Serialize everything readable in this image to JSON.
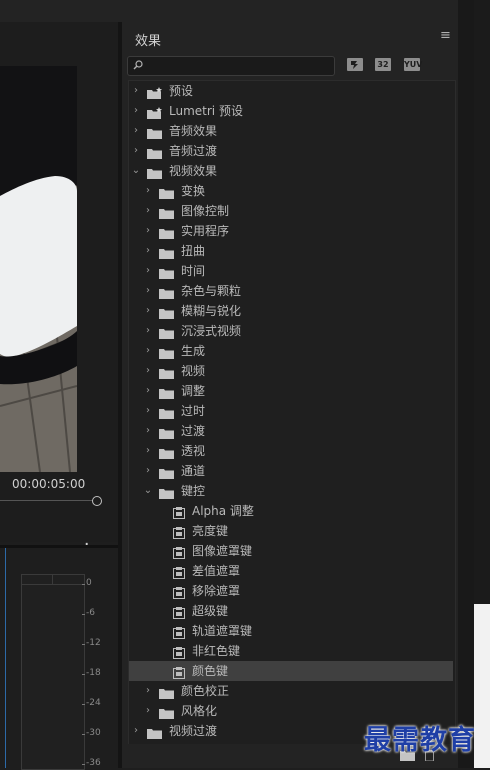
{
  "monitor": {
    "timecode": "00:00:05:00",
    "add_button": "+",
    "meter_scale": [
      "0",
      "-6",
      "-12",
      "-18",
      "-24",
      "-30",
      "-36"
    ]
  },
  "effects_panel": {
    "title": "效果",
    "menu_icon": "hamburger-menu-icon",
    "search": {
      "value": "",
      "icon": "search-icon"
    },
    "toolbar": [
      {
        "name": "accelerated-effects-icon",
        "label": ""
      },
      {
        "name": "32bit-color-icon",
        "label": "32"
      },
      {
        "name": "yuv-effects-icon",
        "label": "YUV"
      }
    ],
    "tree": [
      {
        "label": "预设",
        "level": 0,
        "kind": "star-folder",
        "expanded": false
      },
      {
        "label": "Lumetri 预设",
        "level": 0,
        "kind": "star-folder",
        "expanded": false
      },
      {
        "label": "音频效果",
        "level": 0,
        "kind": "folder",
        "expanded": false
      },
      {
        "label": "音频过渡",
        "level": 0,
        "kind": "folder",
        "expanded": false
      },
      {
        "label": "视频效果",
        "level": 0,
        "kind": "folder",
        "expanded": true
      },
      {
        "label": "变换",
        "level": 1,
        "kind": "folder",
        "expanded": false
      },
      {
        "label": "图像控制",
        "level": 1,
        "kind": "folder",
        "expanded": false
      },
      {
        "label": "实用程序",
        "level": 1,
        "kind": "folder",
        "expanded": false
      },
      {
        "label": "扭曲",
        "level": 1,
        "kind": "folder",
        "expanded": false
      },
      {
        "label": "时间",
        "level": 1,
        "kind": "folder",
        "expanded": false
      },
      {
        "label": "杂色与颗粒",
        "level": 1,
        "kind": "folder",
        "expanded": false
      },
      {
        "label": "模糊与锐化",
        "level": 1,
        "kind": "folder",
        "expanded": false
      },
      {
        "label": "沉浸式视频",
        "level": 1,
        "kind": "folder",
        "expanded": false
      },
      {
        "label": "生成",
        "level": 1,
        "kind": "folder",
        "expanded": false
      },
      {
        "label": "视频",
        "level": 1,
        "kind": "folder",
        "expanded": false
      },
      {
        "label": "调整",
        "level": 1,
        "kind": "folder",
        "expanded": false
      },
      {
        "label": "过时",
        "level": 1,
        "kind": "folder",
        "expanded": false
      },
      {
        "label": "过渡",
        "level": 1,
        "kind": "folder",
        "expanded": false
      },
      {
        "label": "透视",
        "level": 1,
        "kind": "folder",
        "expanded": false
      },
      {
        "label": "通道",
        "level": 1,
        "kind": "folder",
        "expanded": false
      },
      {
        "label": "键控",
        "level": 1,
        "kind": "folder",
        "expanded": true
      },
      {
        "label": "Alpha 调整",
        "level": 2,
        "kind": "effect"
      },
      {
        "label": "亮度键",
        "level": 2,
        "kind": "effect"
      },
      {
        "label": "图像遮罩键",
        "level": 2,
        "kind": "effect"
      },
      {
        "label": "差值遮罩",
        "level": 2,
        "kind": "effect"
      },
      {
        "label": "移除遮罩",
        "level": 2,
        "kind": "effect"
      },
      {
        "label": "超级键",
        "level": 2,
        "kind": "effect"
      },
      {
        "label": "轨道遮罩键",
        "level": 2,
        "kind": "effect"
      },
      {
        "label": "非红色键",
        "level": 2,
        "kind": "effect"
      },
      {
        "label": "颜色键",
        "level": 2,
        "kind": "effect",
        "selected": true
      },
      {
        "label": "颜色校正",
        "level": 1,
        "kind": "folder",
        "expanded": false
      },
      {
        "label": "风格化",
        "level": 1,
        "kind": "folder",
        "expanded": false
      },
      {
        "label": "视频过渡",
        "level": 0,
        "kind": "folder",
        "expanded": false
      }
    ],
    "bottom_icons": [
      "new-bin-icon",
      "delete-icon"
    ]
  },
  "watermark": "最需教育",
  "colors": {
    "panel_bg": "#232323",
    "selection": "#404040",
    "watermark": "#1f3fa6",
    "timeline_accent": "#2d6aa8"
  }
}
